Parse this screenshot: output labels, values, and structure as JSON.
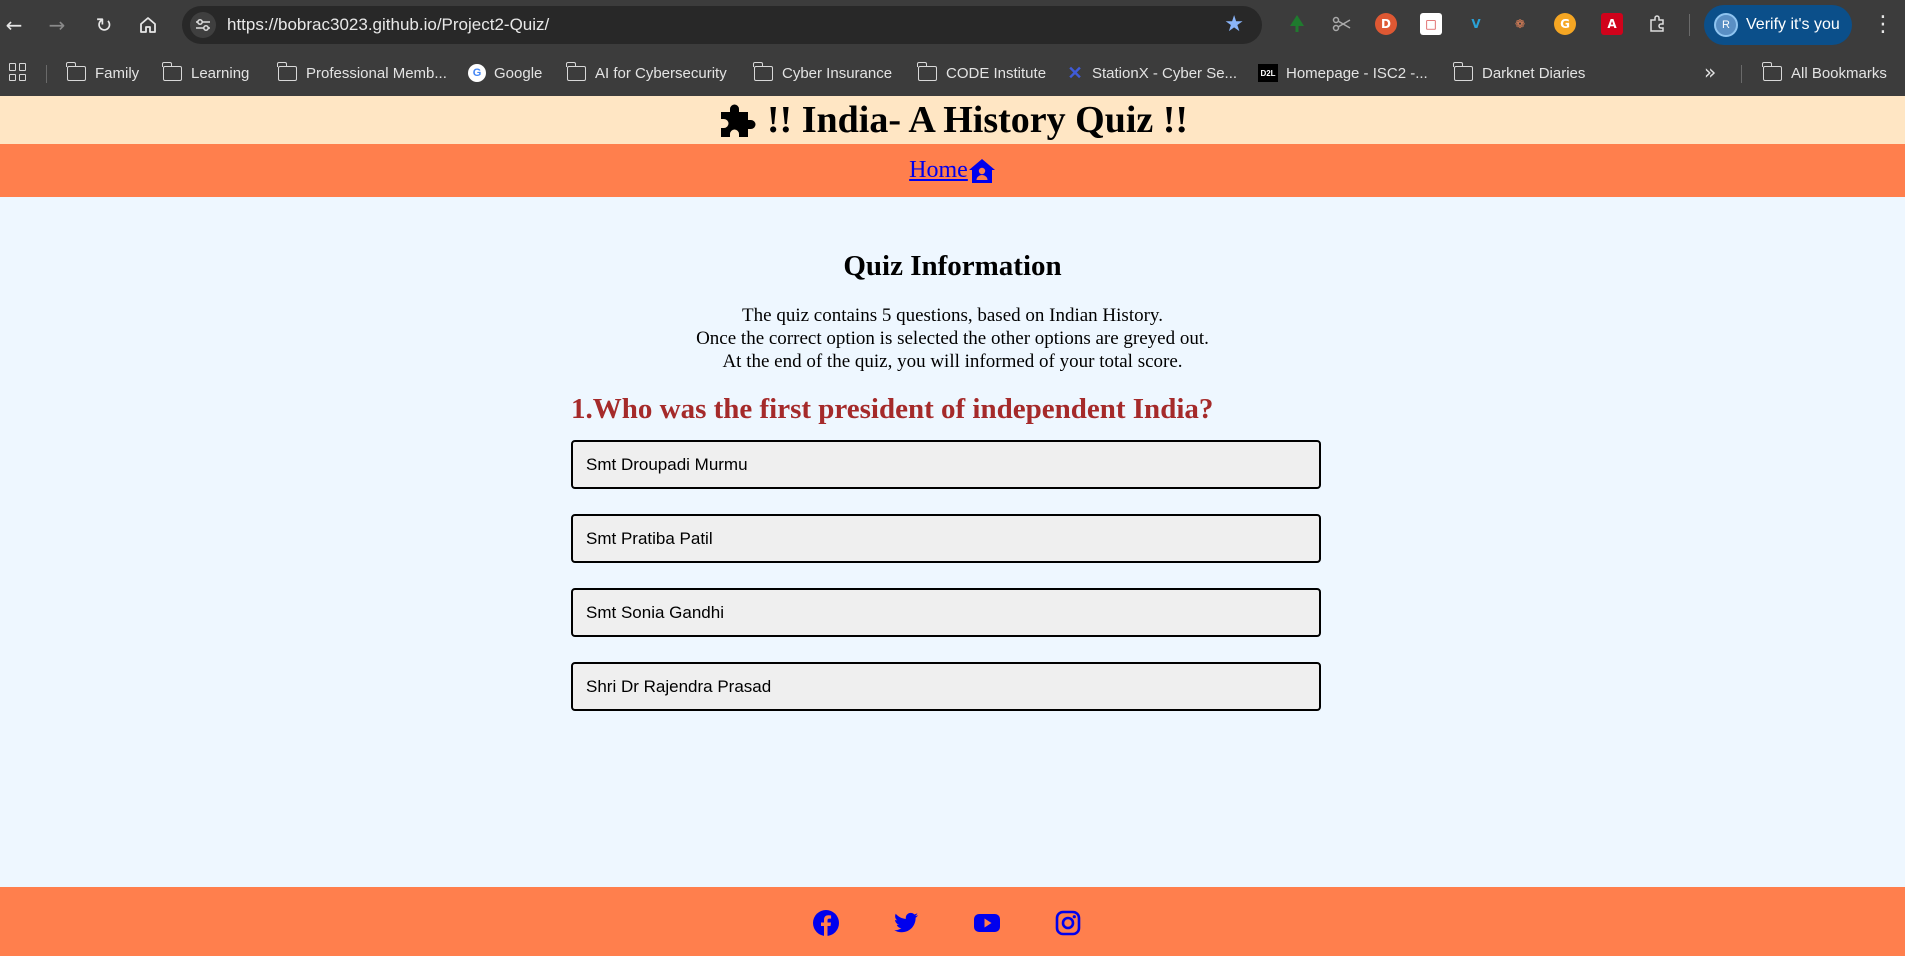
{
  "browser": {
    "url": "https://bobrac3023.github.io/Project2-Quiz/",
    "profile_label": "Verify it's you",
    "profile_initial": "R",
    "bookmarks": [
      "Family",
      "Learning",
      "Professional Memb...",
      "Google",
      "AI for Cybersecurity",
      "Cyber Insurance",
      "CODE Institute",
      "StationX - Cyber Se...",
      "Homepage - ISC2 -...",
      "Darknet Diaries"
    ],
    "all_bookmarks_label": "All Bookmarks"
  },
  "site": {
    "title": "!! India- A History Quiz !!",
    "nav_home": "Home"
  },
  "info": {
    "heading": "Quiz Information",
    "lines": [
      "The quiz contains 5 questions, based on Indian History.",
      "Once the correct option is selected the other options are greyed out.",
      "At the end of the quiz, you will informed of your total score."
    ]
  },
  "quiz": {
    "question": "1.Who was the first president of independent India?",
    "options": [
      "Smt Droupadi Murmu",
      "Smt Pratiba Patil",
      "Smt Sonia Gandhi",
      "Shri Dr Rajendra Prasad"
    ]
  },
  "colors": {
    "header_bg": "#ffe6c4",
    "nav_bg": "#ff7f4d",
    "page_bg": "#eef7ff",
    "question_color": "#a52a2a",
    "link_color": "#0000ee"
  },
  "footer": {
    "icons": [
      "facebook-icon",
      "twitter-icon",
      "youtube-icon",
      "instagram-icon"
    ]
  }
}
